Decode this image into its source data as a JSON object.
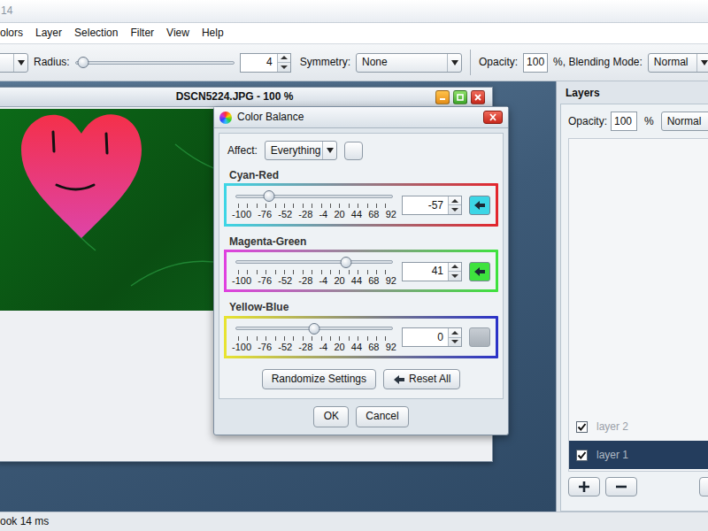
{
  "window": {
    "title": "14"
  },
  "menu": [
    "olors",
    "Layer",
    "Selection",
    "Filter",
    "View",
    "Help"
  ],
  "toolbar": {
    "radius_label": "Radius:",
    "radius_level": 0.05,
    "radius_value": "4",
    "symmetry_label": "Symmetry:",
    "symmetry_value": "None",
    "opacity_label": "Opacity:",
    "opacity_value": "100",
    "blend_label": "%, Blending Mode:",
    "blend_value": "Normal"
  },
  "image_window": {
    "title": "DSCN5224.JPG - 100 %"
  },
  "dialog": {
    "title": "Color Balance",
    "affect_label": "Affect:",
    "affect_value": "Everything",
    "sliders": [
      {
        "name": "Cyan-Red",
        "value": "-57",
        "level": 0.215,
        "reset_enabled": true,
        "color_from": "#3cd6e6",
        "color_to": "#e3262d"
      },
      {
        "name": "Magenta-Green",
        "value": "41",
        "level": 0.705,
        "reset_enabled": true,
        "color_from": "#e040e0",
        "color_to": "#3ee23e"
      },
      {
        "name": "Yellow-Blue",
        "value": "0",
        "level": 0.5,
        "reset_enabled": false,
        "color_from": "#e8e430",
        "color_to": "#2a32c8"
      }
    ],
    "ticks": [
      "-100",
      "-76",
      "-52",
      "-28",
      "-4",
      "20",
      "44",
      "68",
      "92"
    ],
    "randomize_button": "Randomize Settings",
    "reset_all_button": "Reset All",
    "ok_button": "OK",
    "cancel_button": "Cancel"
  },
  "layers": {
    "title": "Layers",
    "opacity_label": "Opacity:",
    "opacity_value": "100",
    "percent": "%",
    "blend_value": "Normal",
    "items": [
      {
        "name": "layer 2",
        "visible": true,
        "selected": false
      },
      {
        "name": "layer 1",
        "visible": true,
        "selected": true
      }
    ]
  },
  "status_bar": "ook 14 ms"
}
